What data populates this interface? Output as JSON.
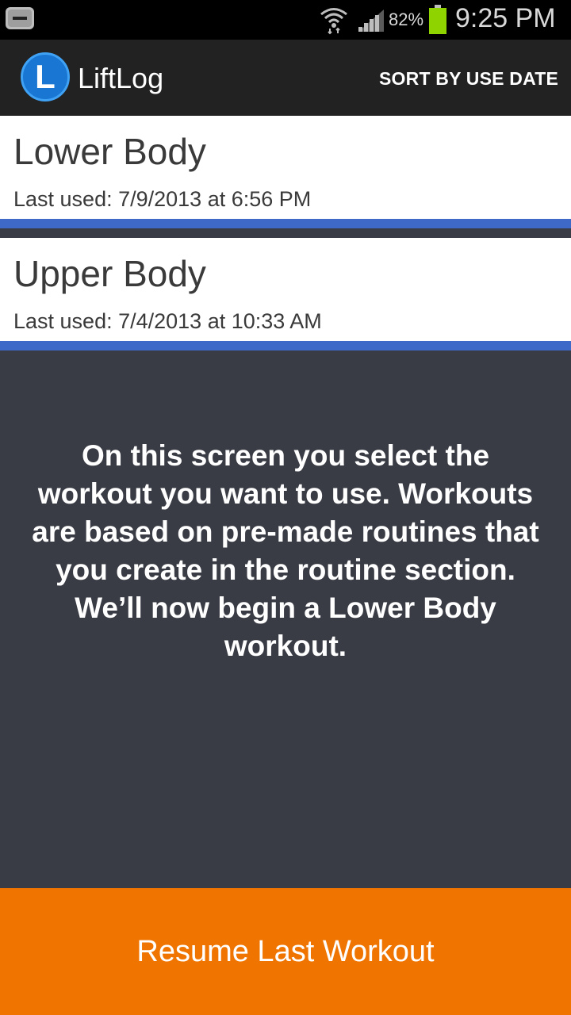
{
  "status_bar": {
    "battery_percent": "82%",
    "time": "9:25 PM",
    "icons": [
      "back-icon",
      "wifi-icon",
      "signal-icon",
      "battery-icon"
    ]
  },
  "action_bar": {
    "logo_letter": "L",
    "title": "LiftLog",
    "sort_label": "SORT BY USE DATE"
  },
  "workouts": [
    {
      "name": "Lower Body",
      "last_used": "Last used: 7/9/2013 at 6:56 PM"
    },
    {
      "name": "Upper Body",
      "last_used": "Last used: 7/4/2013 at 10:33 AM"
    }
  ],
  "tutorial": {
    "text": "On this screen you select the workout you want to use. Workouts are based on pre-made routines that you create in the routine section. We’ll now begin a Lower Body workout."
  },
  "resume_button": {
    "label": "Resume Last Workout"
  },
  "colors": {
    "accent_blue": "#3f69c9",
    "overlay": "#3a3c45",
    "button_orange": "#ef7400",
    "logo_blue": "#1976d2",
    "battery_green": "#8fd400"
  }
}
